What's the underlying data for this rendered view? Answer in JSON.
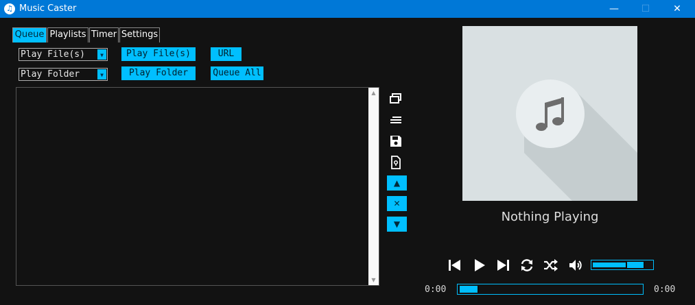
{
  "window": {
    "title": "Music Caster",
    "icon": "music-note-icon",
    "minimize_glyph": "—",
    "maximize_glyph": "☐",
    "close_glyph": "✕"
  },
  "tabs": [
    {
      "label": "Queue",
      "active": true
    },
    {
      "label": "Playlists",
      "active": false
    },
    {
      "label": "Timer",
      "active": false
    },
    {
      "label": "Settings",
      "active": false
    }
  ],
  "queue": {
    "file_select_value": "Play File(s)",
    "folder_select_value": "Play Folder",
    "play_files_label": "Play File(s)",
    "url_label": "URL",
    "play_folder_label": "Play Folder",
    "queue_all_label": "Queue All",
    "items": []
  },
  "side_controls": {
    "icons": [
      "mini-player-icon",
      "queue-list-icon",
      "save-icon",
      "locate-file-icon"
    ],
    "move_up_glyph": "▲",
    "remove_glyph": "✕",
    "move_down_glyph": "▼"
  },
  "player": {
    "now_playing": "Nothing Playing",
    "time_elapsed": "0:00",
    "time_total": "0:00",
    "progress_fraction": 0.0,
    "volume_fraction": 0.82,
    "accent_color": "#00bfff",
    "titlebar_color": "#0078d7",
    "background_color": "#121212"
  }
}
